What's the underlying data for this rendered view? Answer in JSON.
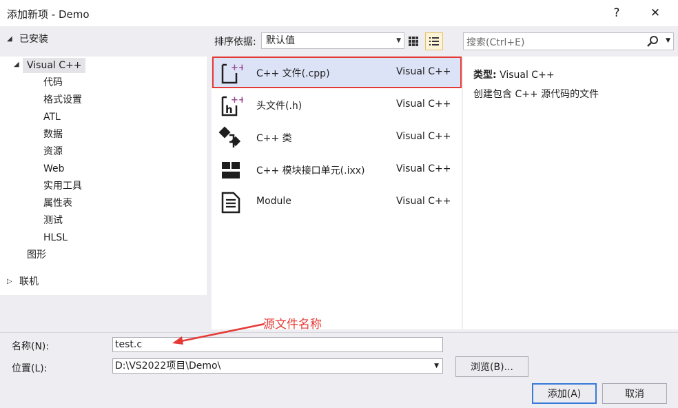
{
  "window": {
    "title": "添加新项 - Demo",
    "help_glyph": "?",
    "close_glyph": "✕"
  },
  "left": {
    "installed_label": "已安装",
    "tree": [
      {
        "label": "Visual C++",
        "selected": true
      },
      {
        "label": "代码"
      },
      {
        "label": "格式设置"
      },
      {
        "label": "ATL"
      },
      {
        "label": "数据"
      },
      {
        "label": "资源"
      },
      {
        "label": "Web"
      },
      {
        "label": "实用工具"
      },
      {
        "label": "属性表"
      },
      {
        "label": "测试"
      },
      {
        "label": "HLSL"
      },
      {
        "label": "图形"
      }
    ],
    "online_label": "联机"
  },
  "toolbar": {
    "sort_label": "排序依据:",
    "sort_value": "默认值"
  },
  "templates": [
    {
      "name": "C++ 文件(.cpp)",
      "lang": "Visual C++",
      "icon": "cpp-file-icon",
      "selected": true
    },
    {
      "name": "头文件(.h)",
      "lang": "Visual C++",
      "icon": "header-file-icon"
    },
    {
      "name": "C++ 类",
      "lang": "Visual C++",
      "icon": "cpp-class-icon"
    },
    {
      "name": "C++ 模块接口单元(.ixx)",
      "lang": "Visual C++",
      "icon": "module-interface-icon"
    },
    {
      "name": "Module",
      "lang": "Visual C++",
      "icon": "module-file-icon"
    }
  ],
  "search": {
    "placeholder": "搜索(Ctrl+E)"
  },
  "details": {
    "type_label": "类型:",
    "type_value": "Visual C++",
    "description": "创建包含 C++ 源代码的文件"
  },
  "annotation": {
    "text": "源文件名称",
    "color": "#e53935"
  },
  "form": {
    "name_label": "名称(N):",
    "name_value": "test.c",
    "location_label": "位置(L):",
    "location_value": "D:\\VS2022项目\\Demo\\",
    "browse_label": "浏览(B)...",
    "add_label": "添加(A)",
    "cancel_label": "取消"
  },
  "colors": {
    "accent": "#3879d9",
    "selection": "#dde3f7",
    "highlight_box": "#e53935",
    "icon_purple": "#9b4f96"
  }
}
